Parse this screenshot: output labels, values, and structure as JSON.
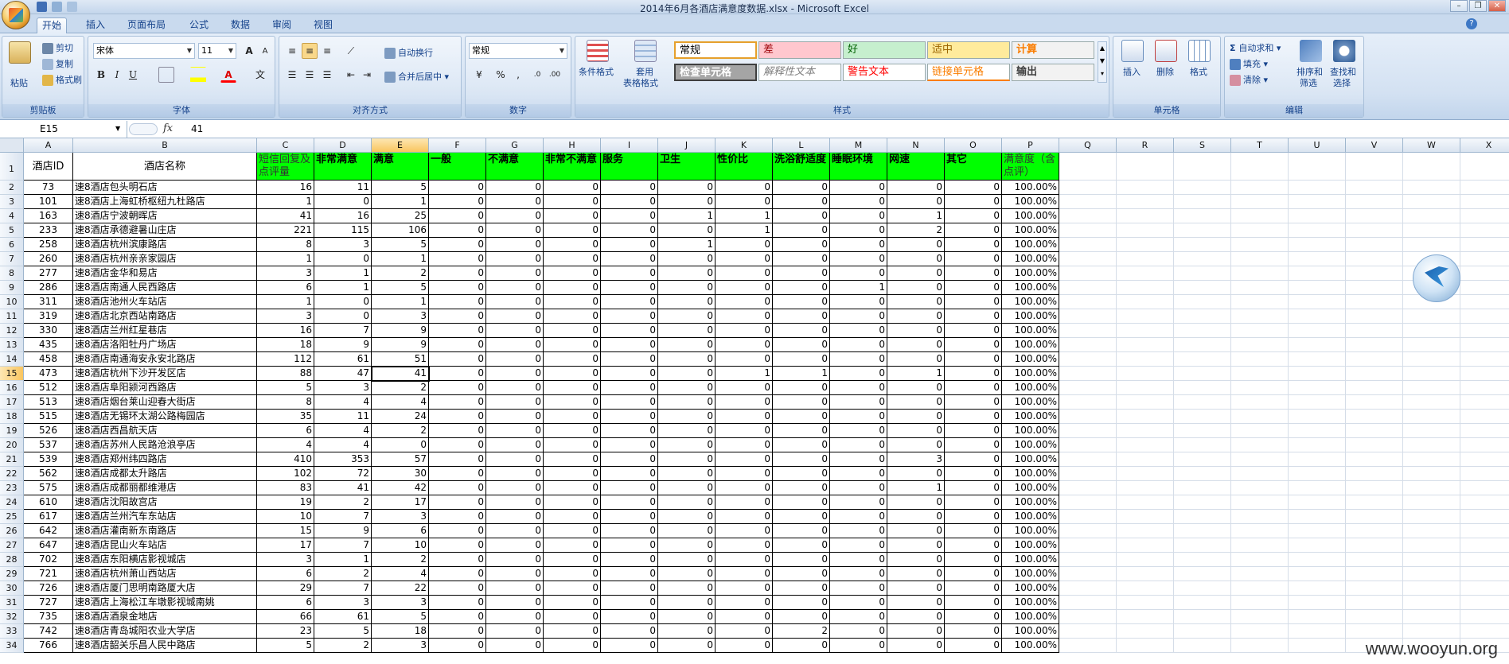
{
  "window": {
    "title": "2014年6月各酒店满意度数据.xlsx - Microsoft Excel",
    "controls": [
      "–",
      "❐",
      "✕"
    ]
  },
  "tabs": [
    "开始",
    "插入",
    "页面布局",
    "公式",
    "数据",
    "审阅",
    "视图"
  ],
  "ribbon": {
    "clipboard": {
      "label": "剪贴板",
      "paste": "粘贴",
      "cut": "剪切",
      "copy": "复制",
      "format_painter": "格式刷"
    },
    "font": {
      "label": "字体",
      "font_name": "宋体",
      "font_size": "11",
      "bold": "B",
      "italic": "I",
      "underline": "U",
      "grow": "A",
      "shrink": "A",
      "phonetic": "文"
    },
    "alignment": {
      "label": "对齐方式",
      "wrap": "自动换行",
      "merge": "合并后居中"
    },
    "number": {
      "label": "数字",
      "format": "常规",
      "percent": "%",
      "comma": ","
    },
    "styles": {
      "label": "样式",
      "conditional": "条件格式",
      "table_line1": "套用",
      "table_line2": "表格格式",
      "cells": [
        {
          "name": "常规",
          "bg": "#ffffff",
          "color": "#000000"
        },
        {
          "name": "差",
          "bg": "#ffc7ce",
          "color": "#9c0006"
        },
        {
          "name": "好",
          "bg": "#c6efce",
          "color": "#006100"
        },
        {
          "name": "适中",
          "bg": "#ffeb9c",
          "color": "#9c6500"
        },
        {
          "name": "计算",
          "bg": "#f2f2f2",
          "color": "#fa7d00"
        },
        {
          "name": "检查单元格",
          "bg": "#a5a5a5",
          "color": "#ffffff"
        },
        {
          "name": "解释性文本",
          "bg": "#ffffff",
          "color": "#7f7f7f"
        },
        {
          "name": "警告文本",
          "bg": "#ffffff",
          "color": "#ff0000"
        },
        {
          "name": "链接单元格",
          "bg": "#ffffff",
          "color": "#fa7d00"
        },
        {
          "name": "输出",
          "bg": "#f2f2f2",
          "color": "#3f3f3f"
        }
      ]
    },
    "cells_group": {
      "label": "单元格",
      "insert": "插入",
      "delete": "删除",
      "format": "格式"
    },
    "editing": {
      "label": "编辑",
      "autosum": "自动求和",
      "fill": "填充",
      "clear": "清除",
      "sort_line1": "排序和",
      "sort_line2": "筛选",
      "find_line1": "查找和",
      "find_line2": "选择"
    }
  },
  "formula_bar": {
    "name_box": "E15",
    "fx": "fx",
    "content": "41"
  },
  "columns": [
    "A",
    "B",
    "C",
    "D",
    "E",
    "F",
    "G",
    "H",
    "I",
    "J",
    "K",
    "L",
    "M",
    "N",
    "O",
    "P",
    "Q",
    "R",
    "S",
    "T",
    "U",
    "V",
    "W",
    "X"
  ],
  "headers": [
    "酒店ID",
    "酒店名称",
    "短信回复及点评量",
    "非常满意",
    "满意",
    "一般",
    "不满意",
    "非常不满意",
    "服务",
    "卫生",
    "性价比",
    "洗浴舒适度",
    "睡眠环境",
    "网速",
    "其它",
    "满意度（含点评）"
  ],
  "rows": [
    [
      "73",
      "速8酒店包头明石店",
      "16",
      "11",
      "5",
      "0",
      "0",
      "0",
      "0",
      "0",
      "0",
      "0",
      "0",
      "0",
      "0",
      "100.00%"
    ],
    [
      "101",
      "速8酒店上海虹桥枢纽九杜路店",
      "1",
      "0",
      "1",
      "0",
      "0",
      "0",
      "0",
      "0",
      "0",
      "0",
      "0",
      "0",
      "0",
      "100.00%"
    ],
    [
      "163",
      "速8酒店宁波朝晖店",
      "41",
      "16",
      "25",
      "0",
      "0",
      "0",
      "0",
      "1",
      "1",
      "0",
      "0",
      "1",
      "0",
      "100.00%"
    ],
    [
      "233",
      "速8酒店承德避暑山庄店",
      "221",
      "115",
      "106",
      "0",
      "0",
      "0",
      "0",
      "0",
      "1",
      "0",
      "0",
      "2",
      "0",
      "100.00%"
    ],
    [
      "258",
      "速8酒店杭州滨康路店",
      "8",
      "3",
      "5",
      "0",
      "0",
      "0",
      "0",
      "1",
      "0",
      "0",
      "0",
      "0",
      "0",
      "100.00%"
    ],
    [
      "260",
      "速8酒店杭州亲亲家园店",
      "1",
      "0",
      "1",
      "0",
      "0",
      "0",
      "0",
      "0",
      "0",
      "0",
      "0",
      "0",
      "0",
      "100.00%"
    ],
    [
      "277",
      "速8酒店金华和易店",
      "3",
      "1",
      "2",
      "0",
      "0",
      "0",
      "0",
      "0",
      "0",
      "0",
      "0",
      "0",
      "0",
      "100.00%"
    ],
    [
      "286",
      "速8酒店南通人民西路店",
      "6",
      "1",
      "5",
      "0",
      "0",
      "0",
      "0",
      "0",
      "0",
      "0",
      "1",
      "0",
      "0",
      "100.00%"
    ],
    [
      "311",
      "速8酒店池州火车站店",
      "1",
      "0",
      "1",
      "0",
      "0",
      "0",
      "0",
      "0",
      "0",
      "0",
      "0",
      "0",
      "0",
      "100.00%"
    ],
    [
      "319",
      "速8酒店北京西站南路店",
      "3",
      "0",
      "3",
      "0",
      "0",
      "0",
      "0",
      "0",
      "0",
      "0",
      "0",
      "0",
      "0",
      "100.00%"
    ],
    [
      "330",
      "速8酒店兰州红星巷店",
      "16",
      "7",
      "9",
      "0",
      "0",
      "0",
      "0",
      "0",
      "0",
      "0",
      "0",
      "0",
      "0",
      "100.00%"
    ],
    [
      "435",
      "速8酒店洛阳牡丹广场店",
      "18",
      "9",
      "9",
      "0",
      "0",
      "0",
      "0",
      "0",
      "0",
      "0",
      "0",
      "0",
      "0",
      "100.00%"
    ],
    [
      "458",
      "速8酒店南通海安永安北路店",
      "112",
      "61",
      "51",
      "0",
      "0",
      "0",
      "0",
      "0",
      "0",
      "0",
      "0",
      "0",
      "0",
      "100.00%"
    ],
    [
      "473",
      "速8酒店杭州下沙开发区店",
      "88",
      "47",
      "41",
      "0",
      "0",
      "0",
      "0",
      "0",
      "1",
      "1",
      "0",
      "1",
      "0",
      "100.00%"
    ],
    [
      "512",
      "速8酒店阜阳颍河西路店",
      "5",
      "3",
      "2",
      "0",
      "0",
      "0",
      "0",
      "0",
      "0",
      "0",
      "0",
      "0",
      "0",
      "100.00%"
    ],
    [
      "513",
      "速8酒店烟台莱山迎春大街店",
      "8",
      "4",
      "4",
      "0",
      "0",
      "0",
      "0",
      "0",
      "0",
      "0",
      "0",
      "0",
      "0",
      "100.00%"
    ],
    [
      "515",
      "速8酒店无锡环太湖公路梅园店",
      "35",
      "11",
      "24",
      "0",
      "0",
      "0",
      "0",
      "0",
      "0",
      "0",
      "0",
      "0",
      "0",
      "100.00%"
    ],
    [
      "526",
      "速8酒店西昌航天店",
      "6",
      "4",
      "2",
      "0",
      "0",
      "0",
      "0",
      "0",
      "0",
      "0",
      "0",
      "0",
      "0",
      "100.00%"
    ],
    [
      "537",
      "速8酒店苏州人民路沧浪亭店",
      "4",
      "4",
      "0",
      "0",
      "0",
      "0",
      "0",
      "0",
      "0",
      "0",
      "0",
      "0",
      "0",
      "100.00%"
    ],
    [
      "539",
      "速8酒店郑州纬四路店",
      "410",
      "353",
      "57",
      "0",
      "0",
      "0",
      "0",
      "0",
      "0",
      "0",
      "0",
      "3",
      "0",
      "100.00%"
    ],
    [
      "562",
      "速8酒店成都太升路店",
      "102",
      "72",
      "30",
      "0",
      "0",
      "0",
      "0",
      "0",
      "0",
      "0",
      "0",
      "0",
      "0",
      "100.00%"
    ],
    [
      "575",
      "速8酒店成都丽都维港店",
      "83",
      "41",
      "42",
      "0",
      "0",
      "0",
      "0",
      "0",
      "0",
      "0",
      "0",
      "1",
      "0",
      "100.00%"
    ],
    [
      "610",
      "速8酒店沈阳故宫店",
      "19",
      "2",
      "17",
      "0",
      "0",
      "0",
      "0",
      "0",
      "0",
      "0",
      "0",
      "0",
      "0",
      "100.00%"
    ],
    [
      "617",
      "速8酒店兰州汽车东站店",
      "10",
      "7",
      "3",
      "0",
      "0",
      "0",
      "0",
      "0",
      "0",
      "0",
      "0",
      "0",
      "0",
      "100.00%"
    ],
    [
      "642",
      "速8酒店灌南新东南路店",
      "15",
      "9",
      "6",
      "0",
      "0",
      "0",
      "0",
      "0",
      "0",
      "0",
      "0",
      "0",
      "0",
      "100.00%"
    ],
    [
      "647",
      "速8酒店昆山火车站店",
      "17",
      "7",
      "10",
      "0",
      "0",
      "0",
      "0",
      "0",
      "0",
      "0",
      "0",
      "0",
      "0",
      "100.00%"
    ],
    [
      "702",
      "速8酒店东阳横店影视城店",
      "3",
      "1",
      "2",
      "0",
      "0",
      "0",
      "0",
      "0",
      "0",
      "0",
      "0",
      "0",
      "0",
      "100.00%"
    ],
    [
      "721",
      "速8酒店杭州萧山西站店",
      "6",
      "2",
      "4",
      "0",
      "0",
      "0",
      "0",
      "0",
      "0",
      "0",
      "0",
      "0",
      "0",
      "100.00%"
    ],
    [
      "726",
      "速8酒店厦门思明南路厦大店",
      "29",
      "7",
      "22",
      "0",
      "0",
      "0",
      "0",
      "0",
      "0",
      "0",
      "0",
      "0",
      "0",
      "100.00%"
    ],
    [
      "727",
      "速8酒店上海松江车墩影视城南姚",
      "6",
      "3",
      "3",
      "0",
      "0",
      "0",
      "0",
      "0",
      "0",
      "0",
      "0",
      "0",
      "0",
      "100.00%"
    ],
    [
      "735",
      "速8酒店酒泉金地店",
      "66",
      "61",
      "5",
      "0",
      "0",
      "0",
      "0",
      "0",
      "0",
      "0",
      "0",
      "0",
      "0",
      "100.00%"
    ],
    [
      "742",
      "速8酒店青岛城阳农业大学店",
      "23",
      "5",
      "18",
      "0",
      "0",
      "0",
      "0",
      "0",
      "0",
      "2",
      "0",
      "0",
      "0",
      "100.00%"
    ],
    [
      "766",
      "速8酒店韶关乐昌人民中路店",
      "5",
      "2",
      "3",
      "0",
      "0",
      "0",
      "0",
      "0",
      "0",
      "0",
      "0",
      "0",
      "0",
      "100.00%"
    ]
  ],
  "watermark": "www.wooyun.org"
}
